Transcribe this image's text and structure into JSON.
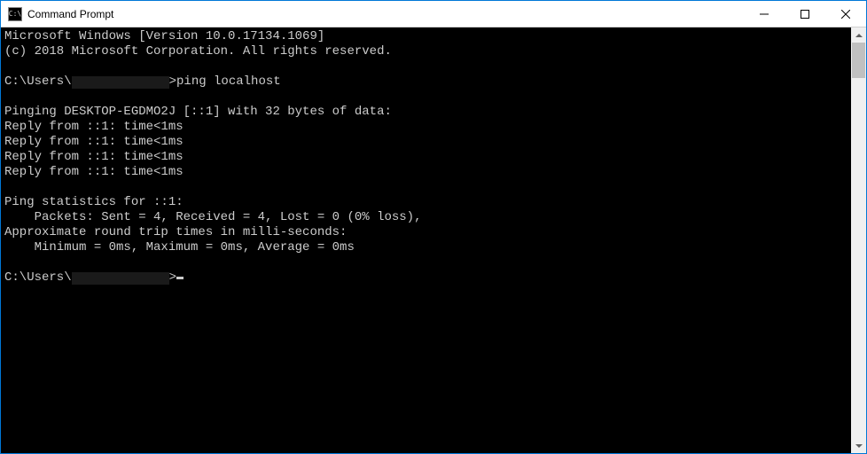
{
  "titlebar": {
    "icon_label": "C:\\",
    "title": "Command Prompt"
  },
  "terminal": {
    "header1": "Microsoft Windows [Version 10.0.17134.1069]",
    "header2": "(c) 2018 Microsoft Corporation. All rights reserved.",
    "prompt_prefix": "C:\\Users\\",
    "prompt_command": ">ping localhost",
    "pinging": "Pinging DESKTOP-EGDMO2J [::1] with 32 bytes of data:",
    "reply1": "Reply from ::1: time<1ms",
    "reply2": "Reply from ::1: time<1ms",
    "reply3": "Reply from ::1: time<1ms",
    "reply4": "Reply from ::1: time<1ms",
    "stats_header": "Ping statistics for ::1:",
    "stats_packets": "    Packets: Sent = 4, Received = 4, Lost = 0 (0% loss),",
    "rtt_header": "Approximate round trip times in milli-seconds:",
    "rtt_values": "    Minimum = 0ms, Maximum = 0ms, Average = 0ms",
    "prompt2_suffix": ">"
  }
}
